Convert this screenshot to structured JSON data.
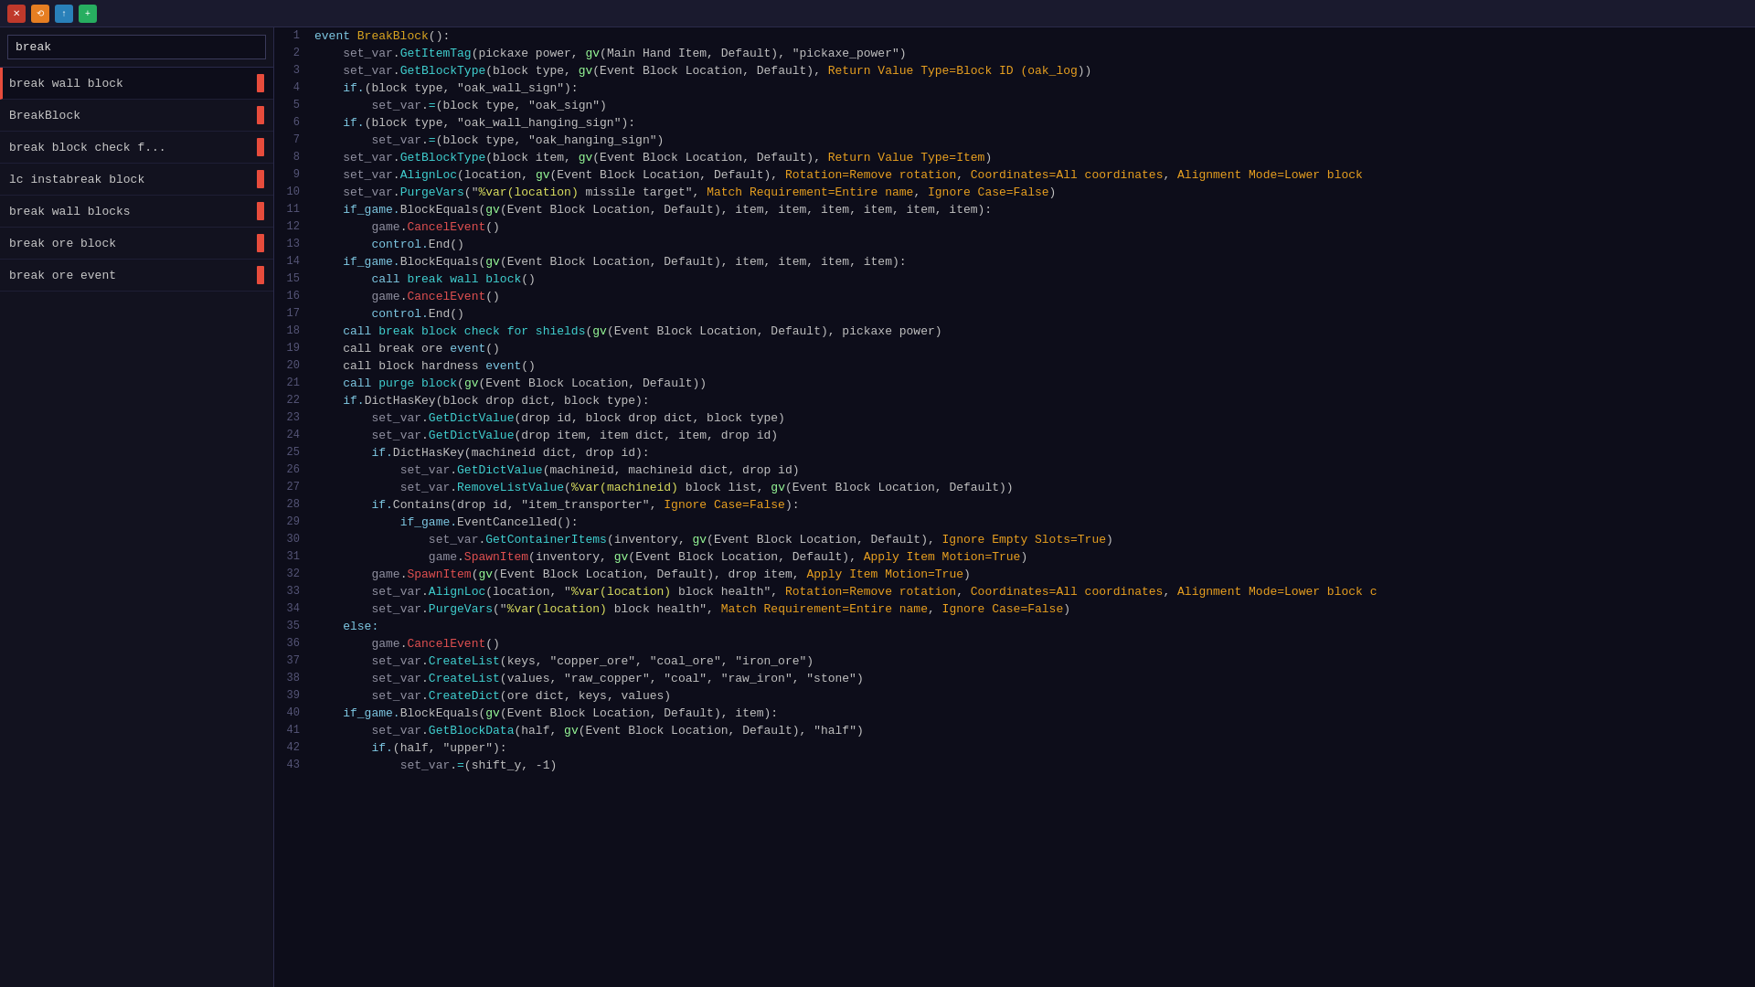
{
  "titlebar": {
    "buttons": [
      {
        "label": "✕",
        "class": "tb-btn-red",
        "name": "close-button"
      },
      {
        "label": "⟲",
        "class": "tb-btn-orange",
        "name": "refresh-button"
      },
      {
        "label": "↑",
        "class": "tb-btn-blue-up",
        "name": "up-button"
      },
      {
        "label": "+",
        "class": "tb-btn-blue-add",
        "name": "add-button"
      }
    ]
  },
  "sidebar": {
    "search_value": "break",
    "search_placeholder": "break",
    "items": [
      {
        "label": "break wall block",
        "active": true,
        "name": "break-wall-block"
      },
      {
        "label": "BreakBlock",
        "active": false,
        "name": "break-block"
      },
      {
        "label": "break block check f...",
        "active": false,
        "name": "break-block-check-f"
      },
      {
        "label": "lc instabreak block",
        "active": false,
        "name": "lc-instabreak-block"
      },
      {
        "label": "break wall blocks",
        "active": false,
        "name": "break-wall-blocks"
      },
      {
        "label": "break ore block",
        "active": false,
        "name": "break-ore-block"
      },
      {
        "label": "break ore event",
        "active": false,
        "name": "break-ore-event"
      }
    ]
  },
  "code": {
    "lines": [
      {
        "num": 1,
        "text": "event BreakBlock():"
      },
      {
        "num": 2,
        "text": "    set_var.GetItemTag(pickaxe power, gv(Main Hand Item, Default), \"pickaxe_power\")"
      },
      {
        "num": 3,
        "text": "    set_var.GetBlockType(block type, gv(Event Block Location, Default), Return Value Type=Block ID (oak_log))"
      },
      {
        "num": 4,
        "text": "    if.(block type, \"oak_wall_sign\"):"
      },
      {
        "num": 5,
        "text": "        set_var.=(block type, \"oak_sign\")"
      },
      {
        "num": 6,
        "text": "    if.(block type, \"oak_wall_hanging_sign\"):"
      },
      {
        "num": 7,
        "text": "        set_var.=(block type, \"oak_hanging_sign\")"
      },
      {
        "num": 8,
        "text": "    set_var.GetBlockType(block item, gv(Event Block Location, Default), Return Value Type=Item)"
      },
      {
        "num": 9,
        "text": "    set_var.AlignLoc(location, gv(Event Block Location, Default), Rotation=Remove rotation, Coordinates=All coordinates, Alignment Mode=Lower block"
      },
      {
        "num": 10,
        "text": "    set_var.PurgeVars(\"%var(location) missile target\", Match Requirement=Entire name, Ignore Case=False)"
      },
      {
        "num": 11,
        "text": "    if_game.BlockEquals(gv(Event Block Location, Default), item, item, item, item, item, item):"
      },
      {
        "num": 12,
        "text": "        game.CancelEvent()"
      },
      {
        "num": 13,
        "text": "        control.End()"
      },
      {
        "num": 14,
        "text": "    if_game.BlockEquals(gv(Event Block Location, Default), item, item, item, item):"
      },
      {
        "num": 15,
        "text": "        call break wall block()"
      },
      {
        "num": 16,
        "text": "        game.CancelEvent()"
      },
      {
        "num": 17,
        "text": "        control.End()"
      },
      {
        "num": 18,
        "text": "    call break block check for shields(gv(Event Block Location, Default), pickaxe power)"
      },
      {
        "num": 19,
        "text": "    call break ore event()"
      },
      {
        "num": 20,
        "text": "    call block hardness event()"
      },
      {
        "num": 21,
        "text": "    call purge block(gv(Event Block Location, Default))"
      },
      {
        "num": 22,
        "text": "    if.DictHasKey(block drop dict, block type):"
      },
      {
        "num": 23,
        "text": "        set_var.GetDictValue(drop id, block drop dict, block type)"
      },
      {
        "num": 24,
        "text": "        set_var.GetDictValue(drop item, item dict, item, drop id)"
      },
      {
        "num": 25,
        "text": "        if.DictHasKey(machineid dict, drop id):"
      },
      {
        "num": 26,
        "text": "            set_var.GetDictValue(machineid, machineid dict, drop id)"
      },
      {
        "num": 27,
        "text": "            set_var.RemoveListValue(%var(machineid) block list, gv(Event Block Location, Default))"
      },
      {
        "num": 28,
        "text": "        if.Contains(drop id, \"item_transporter\", Ignore Case=False):"
      },
      {
        "num": 29,
        "text": "            if_game.EventCancelled():"
      },
      {
        "num": 30,
        "text": "                set_var.GetContainerItems(inventory, gv(Event Block Location, Default), Ignore Empty Slots=True)"
      },
      {
        "num": 31,
        "text": "                game.SpawnItem(inventory, gv(Event Block Location, Default), Apply Item Motion=True)"
      },
      {
        "num": 32,
        "text": "        game.SpawnItem(gv(Event Block Location, Default), drop item, Apply Item Motion=True)"
      },
      {
        "num": 33,
        "text": "        set_var.AlignLoc(location, \"%var(location) block health\", Rotation=Remove rotation, Coordinates=All coordinates, Alignment Mode=Lower block c"
      },
      {
        "num": 34,
        "text": "        set_var.PurgeVars(\"%var(location) block health\", Match Requirement=Entire name, Ignore Case=False)"
      },
      {
        "num": 35,
        "text": "    else:"
      },
      {
        "num": 36,
        "text": "        game.CancelEvent()"
      },
      {
        "num": 37,
        "text": "        set_var.CreateList(keys, \"copper_ore\", \"coal_ore\", \"iron_ore\")"
      },
      {
        "num": 38,
        "text": "        set_var.CreateList(values, \"raw_copper\", \"coal\", \"raw_iron\", \"stone\")"
      },
      {
        "num": 39,
        "text": "        set_var.CreateDict(ore dict, keys, values)"
      },
      {
        "num": 40,
        "text": "    if_game.BlockEquals(gv(Event Block Location, Default), item):"
      },
      {
        "num": 41,
        "text": "        set_var.GetBlockData(half, gv(Event Block Location, Default), \"half\")"
      },
      {
        "num": 42,
        "text": "        if.(half, \"upper\"):"
      },
      {
        "num": 43,
        "text": "            set_var.=(shift_y, -1)"
      }
    ]
  }
}
